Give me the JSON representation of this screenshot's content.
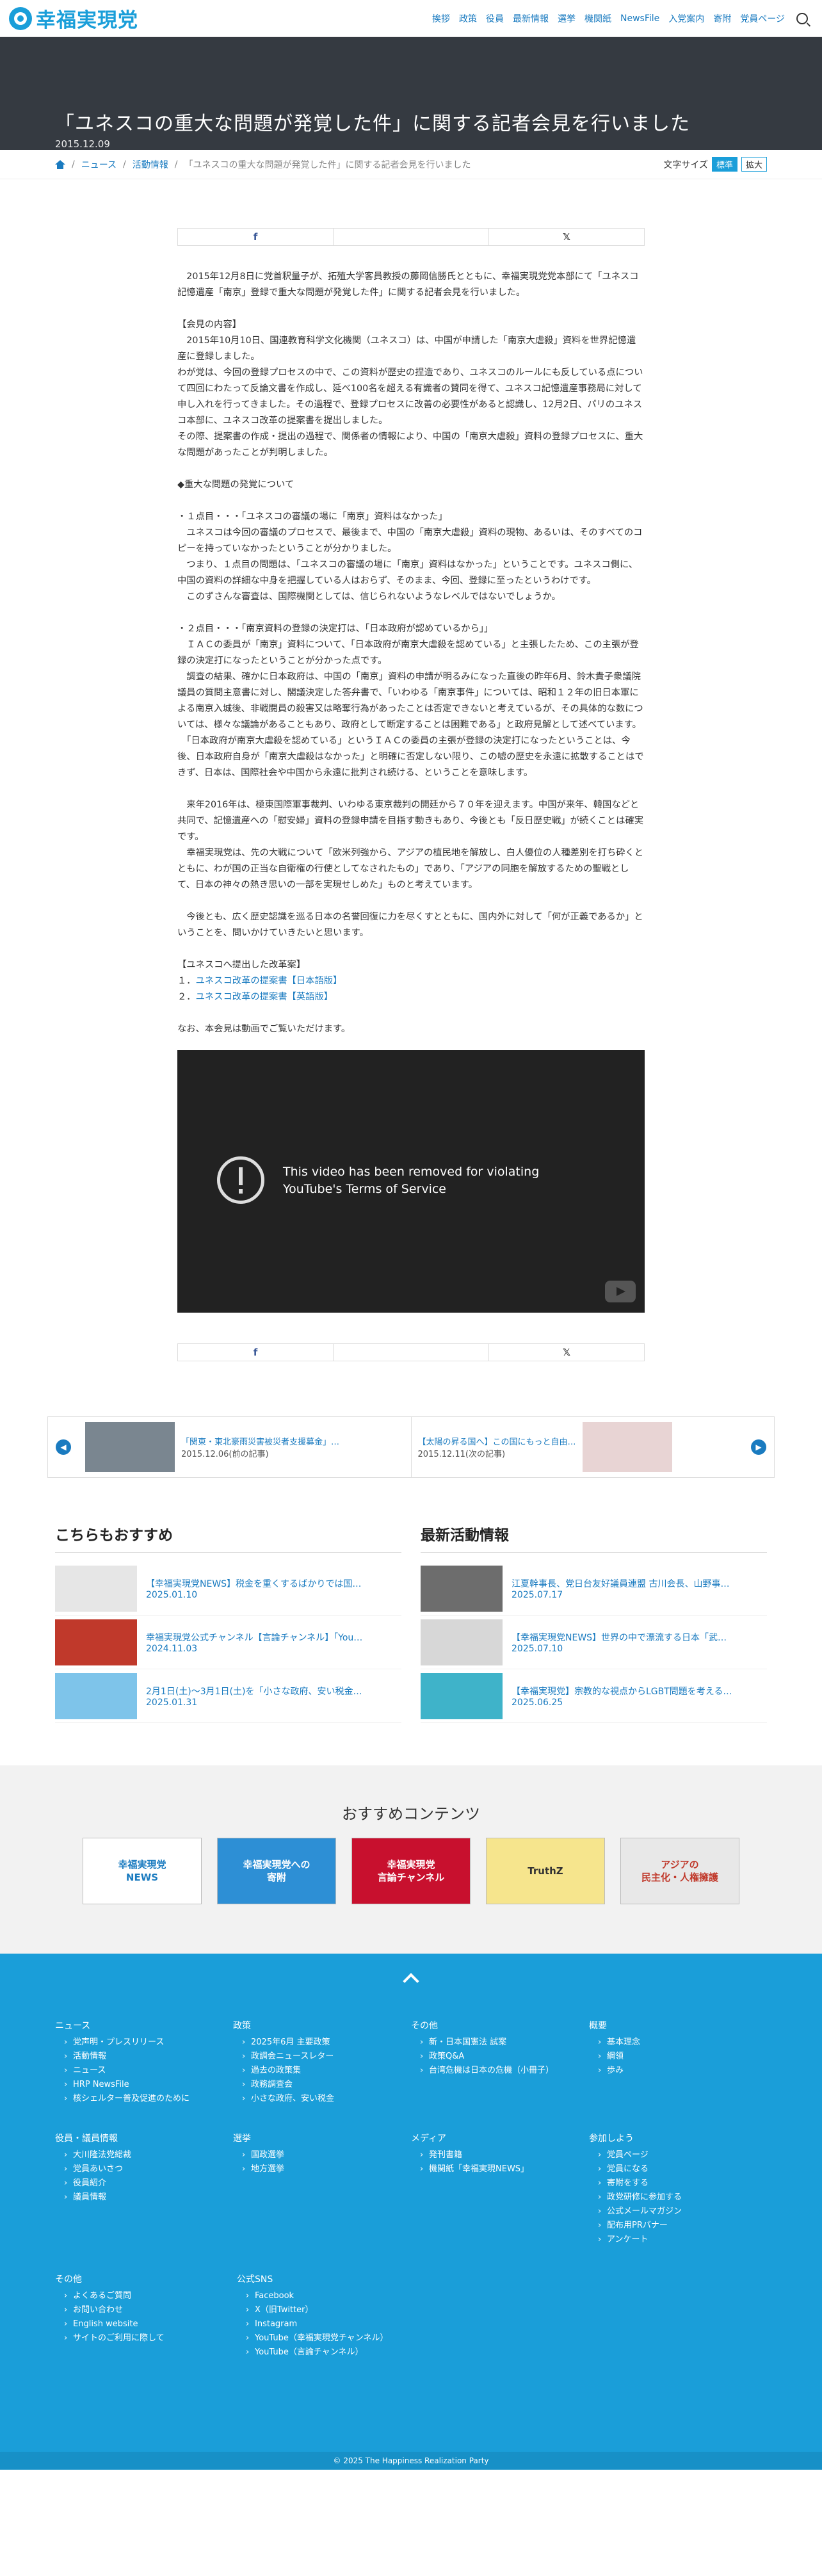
{
  "header": {
    "logo_text": "幸福実現党",
    "nav": [
      "挨拶",
      "政策",
      "役員",
      "最新情報",
      "選挙",
      "機関紙",
      "NewsFile",
      "入党案内",
      "寄附",
      "党員ページ"
    ]
  },
  "hero": {
    "title": "「ユネスコの重大な問題が発覚した件」に関する記者会見を行いました",
    "date": "2015.12.09"
  },
  "breadcrumb": {
    "items": [
      "ニュース",
      "活動情報"
    ],
    "current": "「ユネスコの重大な問題が発覚した件」に関する記者会見を行いました",
    "font_size_label": "文字サイズ",
    "std": "標準",
    "large": "拡大"
  },
  "share": {
    "fb": "f",
    "x": "𝕏"
  },
  "article": {
    "p1": "　2015年12月8日に党首釈量子が、拓殖大学客員教授の藤岡信勝氏とともに、幸福実現党党本部にて「ユネスコ記憶遺産「南京」登録で重大な問題が発覚した件」に関する記者会見を行いました。",
    "p2": "【会見の内容】\n　2015年10月10日、国連教育科学文化機関（ユネスコ）は、中国が申請した「南京大虐殺」資料を世界記憶遺産に登録しました。\nわが党は、今回の登録プロセスの中で、この資料が歴史の捏造であり、ユネスコのルールにも反している点について四回にわたって反論文書を作成し、延べ100名を超える有識者の賛同を得て、ユネスコ記憶遺産事務局に対して申し入れを行ってきました。その過程で、登録プロセスに改善の必要性があると認識し、12月2日、パリのユネスコ本部に、ユネスコ改革の提案書を提出しました。\nその際、提案書の作成・提出の過程で、関係者の情報により、中国の「南京大虐殺」資料の登録プロセスに、重大な問題があったことが判明しました。",
    "p3": "◆重大な問題の発覚について",
    "p4": "・１点目・・・「ユネスコの審議の場に「南京」資料はなかった」\n　ユネスコは今回の審議のプロセスで、最後まで、中国の「南京大虐殺」資料の現物、あるいは、そのすべてのコピーを持っていなかったということが分かりました。\n　つまり、１点目の問題は、「ユネスコの審議の場に「南京」資料はなかった」ということです。ユネスコ側に、中国の資料の詳細な中身を把握している人はおらず、そのまま、今回、登録に至ったというわけです。\n　このずさんな審査は、国際機関としては、信じられないようなレベルではないでしょうか。",
    "p5": "・２点目・・・「南京資料の登録の決定打は、「日本政府が認めているから」」\n　ＩＡＣの委員が「南京」資料について、「日本政府が南京大虐殺を認めている」と主張したため、この主張が登録の決定打になったということが分かった点です。\n　調査の結果、確かに日本政府は、中国の「南京」資料の申請が明るみになった直後の昨年6月、鈴木貴子衆議院議員の質問主意書に対し、閣議決定した答弁書で、「いわゆる「南京事件」については、昭和１２年の旧日本軍による南京入城後、非戦闘員の殺害又は略奪行為があったことは否定できないと考えているが、その具体的な数については、様々な議論があることもあり、政府として断定することは困難である」と政府見解として述べています。\n　「日本政府が南京大虐殺を認めている」というＩＡＣの委員の主張が登録の決定打になったということは、今後、日本政府自身が「南京大虐殺はなかった」と明確に否定しない限り、この嘘の歴史を永遠に拡散することはできず、日本は、国際社会や中国から永遠に批判され続ける、ということを意味します。",
    "p6": "　来年2016年は、極東国際軍事裁判、いわゆる東京裁判の開廷から７０年を迎えます。中国が来年、韓国などと共同で、記憶遺産への「慰安婦」資料の登録申請を目指す動きもあり、今後とも「反日歴史戦」が続くことは確実です。\n　幸福実現党は、先の大戦について「欧米列強から、アジアの植民地を解放し、白人優位の人種差別を打ち砕くとともに、わが国の正当な自衛権の行使としてなされたもの」であり、「アジアの同胞を解放するための聖戦として、日本の神々の熱き思いの一部を実現せしめた」ものと考えています。",
    "p7": "　今後とも、広く歴史認識を巡る日本の名誉回復に力を尽くすとともに、国内外に対して「何が正義であるか」ということを、問いかけていきたいと思います。",
    "p8": "【ユネスコへ提出した改革案】",
    "l1n": "１．",
    "l1": "ユネスコ改革の提案書【日本語版】",
    "l2n": "２．",
    "l2": "ユネスコ改革の提案書【英語版】",
    "p9": "なお、本会見は動画でご覧いただけます。"
  },
  "video": {
    "msg1": "This video has been removed for violating",
    "msg2": "YouTube's Terms of Service"
  },
  "prevnext": {
    "prev_title": "「関東・東北豪雨災害被災者支援募金」…",
    "prev_date": "2015.12.06(前の記事)",
    "next_title": "【太陽の昇る国へ】この国にもっと自由…",
    "next_date": "2015.12.11(次の記事)"
  },
  "recommend": {
    "title": "こちらもおすすめ",
    "items": [
      {
        "t": "【幸福実現党NEWS】税金を重くするばかりでは国…",
        "d": "2025.01.10"
      },
      {
        "t": "幸福実現党公式チャンネル【言論チャンネル】「You…",
        "d": "2024.11.03"
      },
      {
        "t": "2月1日(土)～3月1日(土)を「小さな政府、安い税金…",
        "d": "2025.01.31"
      }
    ]
  },
  "latest": {
    "title": "最新活動情報",
    "items": [
      {
        "t": "江夏幹事長、党日台友好議員連盟 古川会長、山野事…",
        "d": "2025.07.17"
      },
      {
        "t": "【幸福実現党NEWS】世界の中で漂流する日本「武…",
        "d": "2025.07.10"
      },
      {
        "t": "【幸福実現党】宗教的な視点からLGBT問題を考える…",
        "d": "2025.06.25"
      }
    ]
  },
  "osusume": {
    "title": "おすすめコンテンツ",
    "banners": [
      "幸福実現党\nNEWS",
      "幸福実現党への\n寄附",
      "幸福実現党\n言論チャンネル",
      "TruthZ",
      "アジアの\n民主化・人権擁護"
    ]
  },
  "footer": {
    "cols1": [
      {
        "h": "ニュース",
        "li": [
          "党声明・プレスリリース",
          "活動情報",
          "ニュース",
          "HRP NewsFile",
          "核シェルター普及促進のために"
        ]
      },
      {
        "h": "政策",
        "li": [
          "2025年6月 主要政策",
          "政調会ニュースレター",
          "過去の政策集",
          "政務調査会",
          "小さな政府、安い税金"
        ]
      },
      {
        "h": "その他",
        "li": [
          "新・日本国憲法 試案",
          "政策Q&A",
          "台湾危機は日本の危機（小冊子）"
        ]
      },
      {
        "h": "概要",
        "li": [
          "基本理念",
          "綱領",
          "歩み"
        ]
      }
    ],
    "cols2": [
      {
        "h": "役員・議員情報",
        "li": [
          "大川隆法党総裁",
          "党員あいさつ",
          "役員紹介",
          "議員情報"
        ]
      },
      {
        "h": "選挙",
        "li": [
          "国政選挙",
          "地方選挙"
        ]
      },
      {
        "h": "メディア",
        "li": [
          "発刊書籍",
          "機関紙「幸福実現NEWS」"
        ]
      },
      {
        "h": "参加しよう",
        "li": [
          "党員ページ",
          "党員になる",
          "寄附をする",
          "政党研修に参加する",
          "公式メールマガジン",
          "配布用PRバナー",
          "アンケート"
        ]
      }
    ],
    "cols3": [
      {
        "h": "その他",
        "li": [
          "よくあるご質問",
          "お問い合わせ",
          "English website",
          "サイトのご利用に際して"
        ]
      },
      {
        "h": "公式SNS",
        "li": [
          "Facebook",
          "X（旧Twitter）",
          "Instagram",
          "YouTube（幸福実現党チャンネル）",
          "YouTube（言論チャンネル）"
        ]
      }
    ],
    "copyright": "© 2025 The Happiness Realization Party"
  },
  "colors": {
    "brand": "#1a9ed9",
    "hero_bg": "#353a41",
    "link": "#1a7bc0"
  }
}
